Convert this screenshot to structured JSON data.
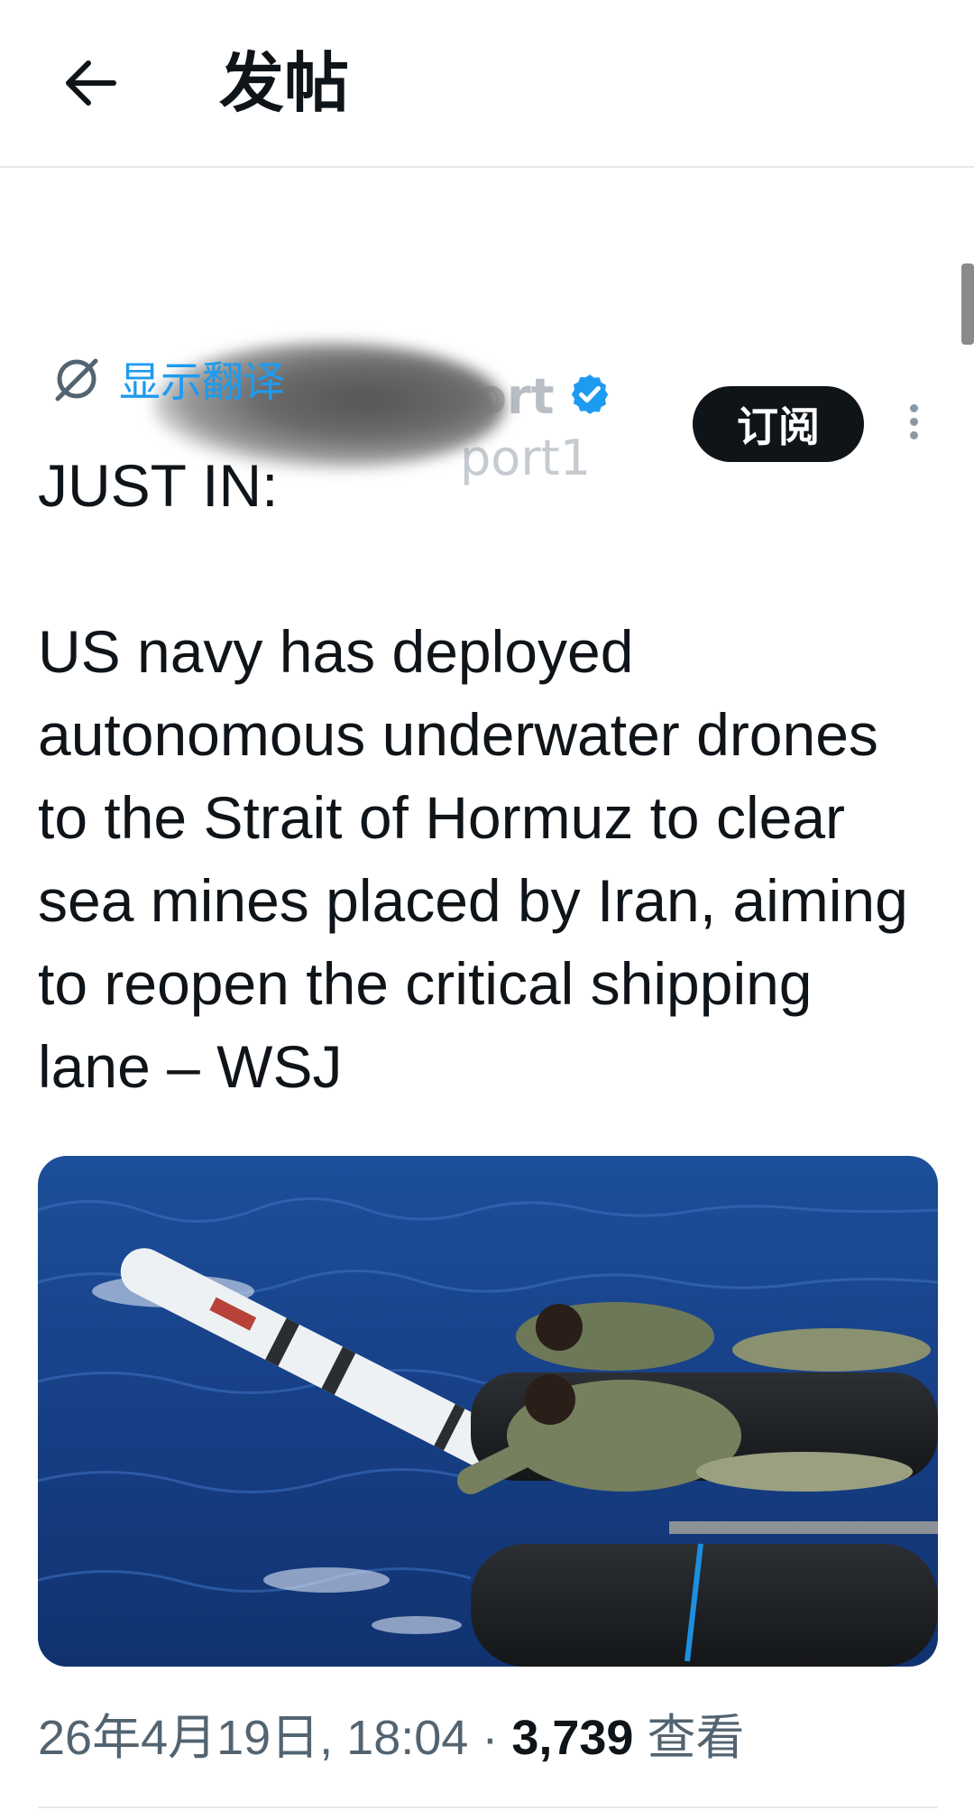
{
  "header": {
    "title": "发帖"
  },
  "author": {
    "name_visible": "ort",
    "handle_visible": "port1",
    "subscribe_label": "订阅"
  },
  "translate": {
    "label": "显示翻译"
  },
  "tweet": {
    "text": "JUST IN:\n\nUS navy has deployed autonomous underwater drones to the Strait of Hormuz to clear sea mines placed by Iran, aiming to reopen the critical shipping lane – WSJ"
  },
  "meta": {
    "date": "26年4月19日, 18:04",
    "separator": " · ",
    "views_count": "3,739",
    "views_label": " 查看"
  },
  "colors": {
    "accent": "#1d9bf0",
    "text": "#0f1419",
    "muted": "#536471"
  }
}
